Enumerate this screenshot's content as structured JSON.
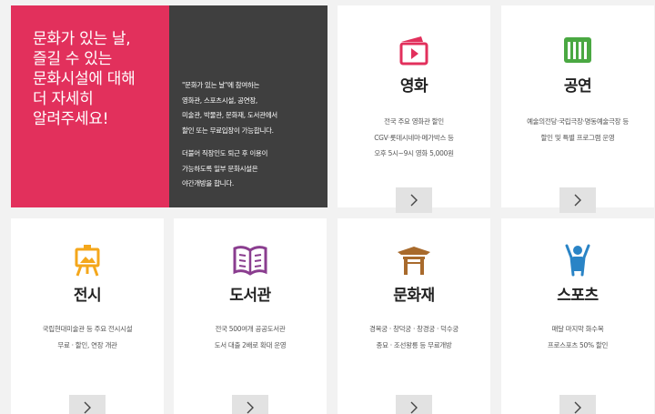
{
  "hero": {
    "headline": "문화가 있는 날,\n즐길 수 있는\n문화시설에 대해\n더 자세히\n알려주세요!",
    "para1": "\"문화가 있는 날\"에 참여하는\n영화관, 스포츠시설, 공연장,\n미술관, 박물관, 문화재, 도서관에서\n할인 또는 무료입장이 가능합니다.",
    "para2": "더불어 직장인도 퇴근 후 이용이\n가능하도록 일부 문화시설은\n야간개방을 합니다."
  },
  "cards": [
    {
      "key": "movie",
      "title": "영화",
      "desc": "전국 주요 영화관 할인\nCGV·롯데시네마·메가박스 등\n오후 5시~9시 영화 5,000원",
      "icon": "clapperboard-icon",
      "color": "#e2305c"
    },
    {
      "key": "performance",
      "title": "공연",
      "desc": "예술의전당·국립극장·명동예술극장 등\n할인 및 특별 프로그램 운영",
      "icon": "piano-keys-icon",
      "color": "#4aa842"
    },
    {
      "key": "exhibition",
      "title": "전시",
      "desc": "국립현대미술관 등 주요 전시시설\n무료 · 할인, 연장 개관",
      "icon": "easel-icon",
      "color": "#f4a71b"
    },
    {
      "key": "library",
      "title": "도서관",
      "desc": "전국 500여개 공공도서관\n도서 대출 2배로 확대 운영",
      "icon": "book-icon",
      "color": "#8a3d8f"
    },
    {
      "key": "heritage",
      "title": "문화재",
      "desc": "경복궁 · 창덕궁 · 창경궁 · 덕수궁\n종묘 · 조선왕릉 등 무료개방",
      "icon": "gate-icon",
      "color": "#a86a2c"
    },
    {
      "key": "sports",
      "title": "스포츠",
      "desc": "매달 마지막 화수목\n프로스포츠 50% 할인",
      "icon": "cheering-person-icon",
      "color": "#2a84c6"
    }
  ],
  "more_icon": "chevron-right-icon",
  "accent": "#e2305c",
  "dark": "#3f3f3f"
}
